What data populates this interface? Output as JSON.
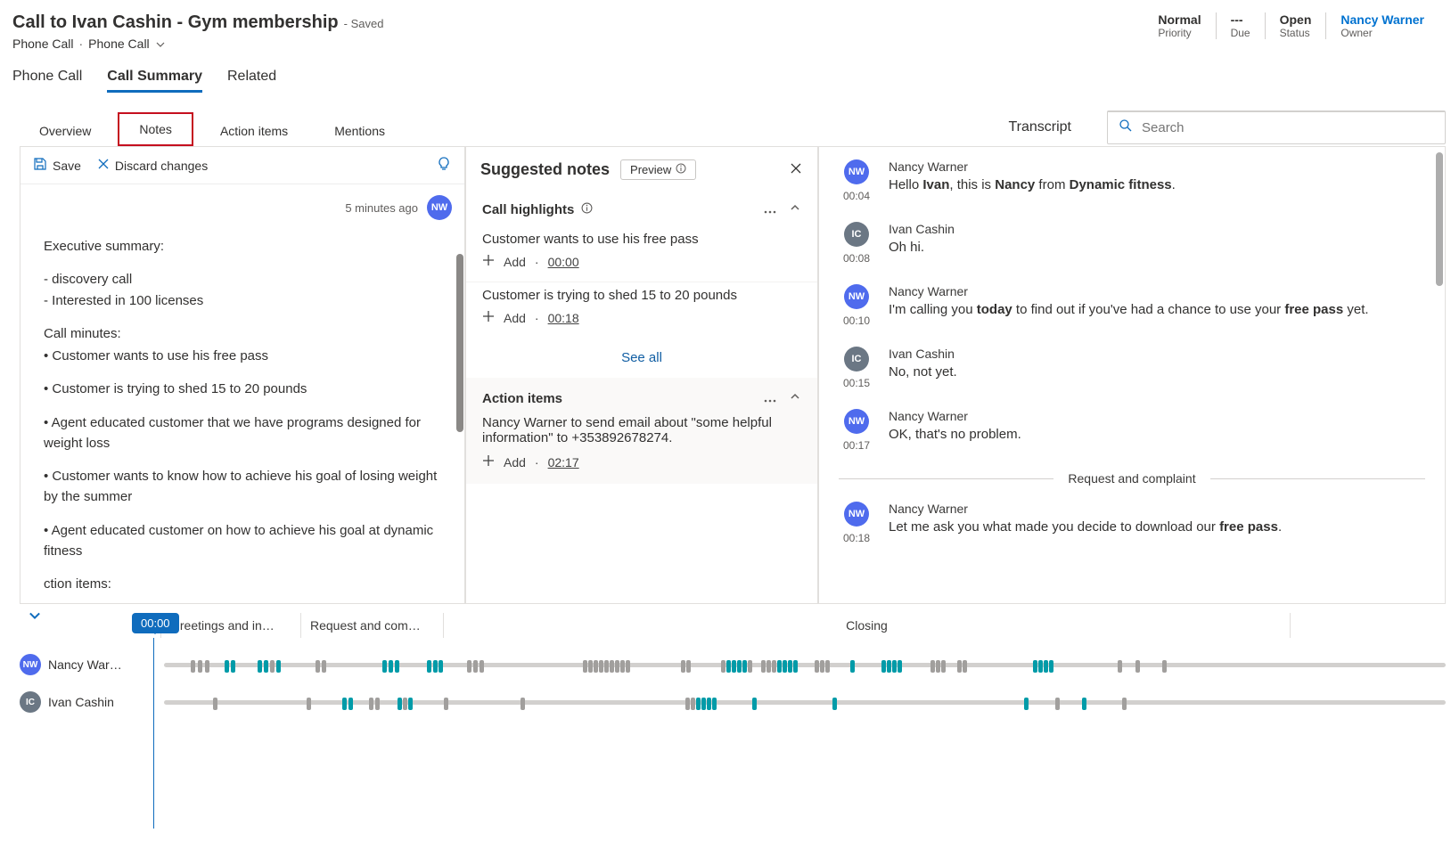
{
  "header": {
    "title": "Call to Ivan Cashin - Gym membership",
    "saved_label": "- Saved",
    "subtitle_a": "Phone Call",
    "subtitle_b": "Phone Call"
  },
  "stats": {
    "priority_v": "Normal",
    "priority_l": "Priority",
    "due_v": "---",
    "due_l": "Due",
    "status_v": "Open",
    "status_l": "Status",
    "owner_v": "Nancy Warner",
    "owner_l": "Owner"
  },
  "tabs": {
    "phone_call": "Phone Call",
    "call_summary": "Call Summary",
    "related": "Related"
  },
  "subtabs": {
    "overview": "Overview",
    "notes": "Notes",
    "action_items": "Action items",
    "mentions": "Mentions"
  },
  "transcript_label": "Transcript",
  "search_placeholder": "Search",
  "notes_toolbar": {
    "save": "Save",
    "discard": "Discard changes"
  },
  "notes_meta": {
    "ago": "5 minutes ago",
    "initials": "NW"
  },
  "notes_body": {
    "h": "Executive summary:",
    "b1": "- discovery call",
    "b2": "- Interested in 100 licenses",
    "m_h": "Call minutes:",
    "m1": "• Customer wants to use his free pass",
    "m2": "• Customer is trying to shed 15 to 20 pounds",
    "m3": "• Agent educated customer that we have programs designed for weight loss",
    "m4": "• Customer wants to know how to achieve his goal of losing weight by the summer",
    "m5": "• Agent educated customer on how to achieve his goal at dynamic fitness",
    "m6": "ction items:"
  },
  "sugg": {
    "title": "Suggested notes",
    "preview": "Preview",
    "highlights_h": "Call highlights",
    "h1": "Customer wants to use his free pass",
    "h1_ts": "00:00",
    "h2": "Customer is trying to shed 15 to 20 pounds",
    "h2_ts": "00:18",
    "add": "Add",
    "see_all": "See all",
    "ai_h": "Action items",
    "ai_text": "Nancy Warner to send email about \"some helpful information\" to +353892678274.",
    "ai_ts": "02:17"
  },
  "tx": {
    "r1": {
      "init": "NW",
      "cls": "nw",
      "speaker": "Nancy Warner",
      "time": "00:04",
      "pre": "Hello ",
      "b1": "Ivan",
      "mid": ", this is ",
      "b2": "Nancy",
      "mid2": " from ",
      "b3": "Dynamic fitness",
      "post": "."
    },
    "r2": {
      "init": "IC",
      "cls": "ic",
      "speaker": "Ivan Cashin",
      "time": "00:08",
      "text": "Oh hi."
    },
    "r3": {
      "init": "NW",
      "cls": "nw",
      "speaker": "Nancy Warner",
      "time": "00:10",
      "pre": "I'm calling you ",
      "b1": "today",
      "mid": " to find out if you've had a chance to use your ",
      "b2": "free pass",
      "post": " yet."
    },
    "r4": {
      "init": "IC",
      "cls": "ic",
      "speaker": "Ivan Cashin",
      "time": "00:15",
      "text": "No, not yet."
    },
    "r5": {
      "init": "NW",
      "cls": "nw",
      "speaker": "Nancy Warner",
      "time": "00:17",
      "text": "OK, that's no problem."
    },
    "divider": "Request and complaint",
    "r6": {
      "init": "NW",
      "cls": "nw",
      "speaker": "Nancy Warner",
      "time": "00:18",
      "pre": "Let me ask you what made you decide to download our ",
      "b1": "free pass",
      "post": "."
    }
  },
  "timeline": {
    "playhead": "00:00",
    "segments": {
      "s1": "Greetings and in…",
      "w1": 158,
      "s2": "Request and com…",
      "w2": 160,
      "s3": "Closing",
      "w3": 950
    },
    "tracks": {
      "t1": {
        "label": "Nancy War…",
        "init": "NW",
        "cls": "nw",
        "ticks": [
          {
            "p": 3,
            "c": "g"
          },
          {
            "p": 3.8,
            "c": "g"
          },
          {
            "p": 4.6,
            "c": "g"
          },
          {
            "p": 6.8,
            "c": "b"
          },
          {
            "p": 7.5,
            "c": "b"
          },
          {
            "p": 10.5,
            "c": "b"
          },
          {
            "p": 11.2,
            "c": "b"
          },
          {
            "p": 11.9,
            "c": "g"
          },
          {
            "p": 12.6,
            "c": "b"
          },
          {
            "p": 17,
            "c": "g"
          },
          {
            "p": 17.7,
            "c": "g"
          },
          {
            "p": 24.5,
            "c": "b"
          },
          {
            "p": 25.2,
            "c": "b"
          },
          {
            "p": 25.9,
            "c": "b"
          },
          {
            "p": 29.5,
            "c": "b"
          },
          {
            "p": 30.2,
            "c": "b"
          },
          {
            "p": 30.8,
            "c": "b"
          },
          {
            "p": 34,
            "c": "g"
          },
          {
            "p": 34.7,
            "c": "g"
          },
          {
            "p": 35.4,
            "c": "g"
          },
          {
            "p": 47,
            "c": "g"
          },
          {
            "p": 47.6,
            "c": "g"
          },
          {
            "p": 48.2,
            "c": "g"
          },
          {
            "p": 48.8,
            "c": "g"
          },
          {
            "p": 49.4,
            "c": "g"
          },
          {
            "p": 50,
            "c": "g"
          },
          {
            "p": 50.6,
            "c": "g"
          },
          {
            "p": 51.2,
            "c": "g"
          },
          {
            "p": 51.8,
            "c": "g"
          },
          {
            "p": 58,
            "c": "g"
          },
          {
            "p": 58.6,
            "c": "g"
          },
          {
            "p": 62.5,
            "c": "g"
          },
          {
            "p": 63.1,
            "c": "b"
          },
          {
            "p": 63.7,
            "c": "b"
          },
          {
            "p": 64.3,
            "c": "b"
          },
          {
            "p": 64.9,
            "c": "b"
          },
          {
            "p": 65.5,
            "c": "g"
          },
          {
            "p": 67,
            "c": "g"
          },
          {
            "p": 67.6,
            "c": "g"
          },
          {
            "p": 68.2,
            "c": "g"
          },
          {
            "p": 68.8,
            "c": "b"
          },
          {
            "p": 69.4,
            "c": "b"
          },
          {
            "p": 70,
            "c": "b"
          },
          {
            "p": 70.6,
            "c": "b"
          },
          {
            "p": 73,
            "c": "g"
          },
          {
            "p": 73.6,
            "c": "g"
          },
          {
            "p": 74.2,
            "c": "g"
          },
          {
            "p": 77,
            "c": "b"
          },
          {
            "p": 80.5,
            "c": "b"
          },
          {
            "p": 81.1,
            "c": "b"
          },
          {
            "p": 81.7,
            "c": "b"
          },
          {
            "p": 82.3,
            "c": "b"
          },
          {
            "p": 86,
            "c": "g"
          },
          {
            "p": 86.6,
            "c": "g"
          },
          {
            "p": 87.2,
            "c": "g"
          },
          {
            "p": 89,
            "c": "g"
          },
          {
            "p": 89.6,
            "c": "g"
          },
          {
            "p": 97.5,
            "c": "b"
          },
          {
            "p": 98.1,
            "c": "b"
          },
          {
            "p": 98.7,
            "c": "b"
          },
          {
            "p": 99.3,
            "c": "b"
          },
          {
            "p": 107,
            "c": "g"
          },
          {
            "p": 109,
            "c": "g"
          },
          {
            "p": 112,
            "c": "g"
          }
        ]
      },
      "t2": {
        "label": "Ivan Cashin",
        "init": "IC",
        "cls": "ic",
        "ticks": [
          {
            "p": 5.5,
            "c": "g"
          },
          {
            "p": 16,
            "c": "g"
          },
          {
            "p": 20,
            "c": "b"
          },
          {
            "p": 20.7,
            "c": "b"
          },
          {
            "p": 23,
            "c": "g"
          },
          {
            "p": 23.7,
            "c": "g"
          },
          {
            "p": 26.2,
            "c": "b"
          },
          {
            "p": 26.8,
            "c": "g"
          },
          {
            "p": 27.4,
            "c": "b"
          },
          {
            "p": 31.4,
            "c": "g"
          },
          {
            "p": 40,
            "c": "g"
          },
          {
            "p": 58.5,
            "c": "g"
          },
          {
            "p": 59.1,
            "c": "g"
          },
          {
            "p": 59.7,
            "c": "b"
          },
          {
            "p": 60.3,
            "c": "b"
          },
          {
            "p": 60.9,
            "c": "b"
          },
          {
            "p": 61.5,
            "c": "b"
          },
          {
            "p": 66,
            "c": "b"
          },
          {
            "p": 75,
            "c": "b"
          },
          {
            "p": 96.5,
            "c": "b"
          },
          {
            "p": 100,
            "c": "g"
          },
          {
            "p": 103,
            "c": "b"
          },
          {
            "p": 107.5,
            "c": "g"
          }
        ]
      }
    }
  }
}
